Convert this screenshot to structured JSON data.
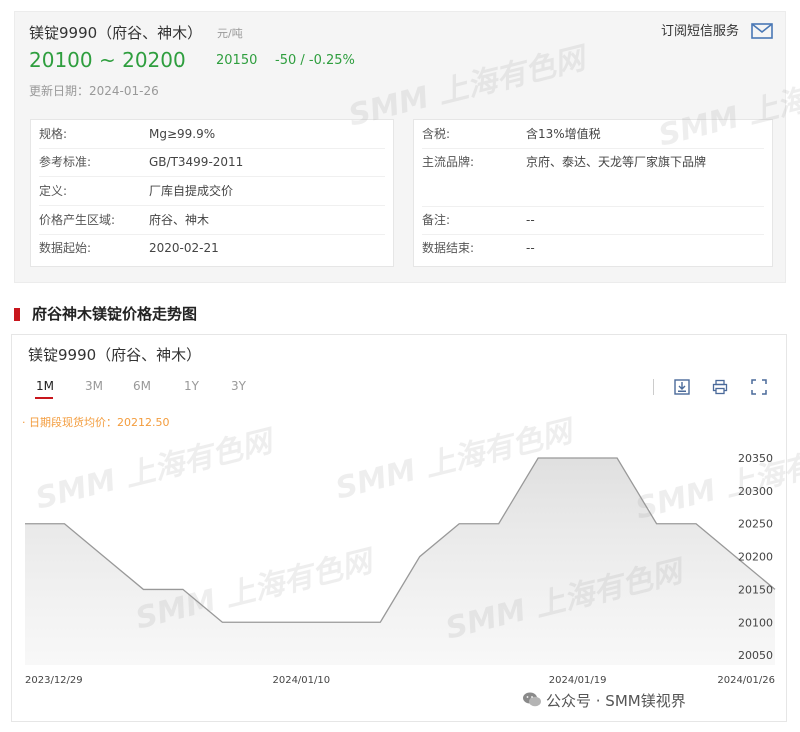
{
  "product": {
    "title": "镁锭9990（府谷、神木）",
    "unit": "元/吨",
    "range": "20100 ~ 20200",
    "avg": "20150",
    "change": "-50  /  -0.25%",
    "updated": "更新日期：2024-01-26",
    "subscribe_label": "订阅短信服务"
  },
  "spec_left": [
    {
      "key": "规格:",
      "value": "Mg≥99.9%"
    },
    {
      "key": "参考标准:",
      "value": "GB/T3499-2011"
    },
    {
      "key": "定义:",
      "value": "厂库自提成交价"
    },
    {
      "key": "价格产生区域:",
      "value": "府谷、神木"
    },
    {
      "key": "数据起始:",
      "value": "2020-02-21"
    }
  ],
  "spec_right": [
    {
      "key": "含税:",
      "value": "含13%增值税"
    },
    {
      "key": "主流品牌:",
      "value": "京府、泰达、天龙等厂家旗下品牌"
    },
    {
      "key": "",
      "value": ""
    },
    {
      "key": "备注:",
      "value": "--"
    },
    {
      "key": "数据结束:",
      "value": "--"
    }
  ],
  "section_title": "府谷神木镁锭价格走势图",
  "chart_panel": {
    "title": "镁锭9990（府谷、神木）",
    "tabs": [
      "1M",
      "3M",
      "6M",
      "1Y",
      "3Y"
    ],
    "active_tab": "1M",
    "avg_note": "· 日期段现货均价：20212.50"
  },
  "watermark_text": "SMM 上海有色网",
  "footer_brand": "公众号 · SMM镁视界",
  "colors": {
    "down": "#2e9e3e",
    "accent": "#c8161d",
    "line": "#999999",
    "note": "#f39c3d"
  },
  "chart_data": {
    "type": "area",
    "x": [
      "2023/12/29",
      "2024/01/02",
      "2024/01/03",
      "2024/01/04",
      "2024/01/05",
      "2024/01/08",
      "2024/01/09",
      "2024/01/10",
      "2024/01/11",
      "2024/01/12",
      "2024/01/15",
      "2024/01/16",
      "2024/01/17",
      "2024/01/18",
      "2024/01/19",
      "2024/01/22",
      "2024/01/23",
      "2024/01/24",
      "2024/01/25",
      "2024/01/26"
    ],
    "values": [
      20250,
      20250,
      20200,
      20150,
      20150,
      20100,
      20100,
      20100,
      20100,
      20100,
      20200,
      20250,
      20250,
      20350,
      20350,
      20350,
      20250,
      20250,
      20200,
      20150
    ],
    "xticks": [
      "2023/12/29",
      "2024/01/10",
      "2024/01/19",
      "2024/01/26"
    ],
    "yticks": [
      20050,
      20100,
      20150,
      20200,
      20250,
      20300,
      20350
    ],
    "ylim": [
      20035,
      20385
    ],
    "grid": false,
    "title": "镁锭9990（府谷、神木）"
  }
}
